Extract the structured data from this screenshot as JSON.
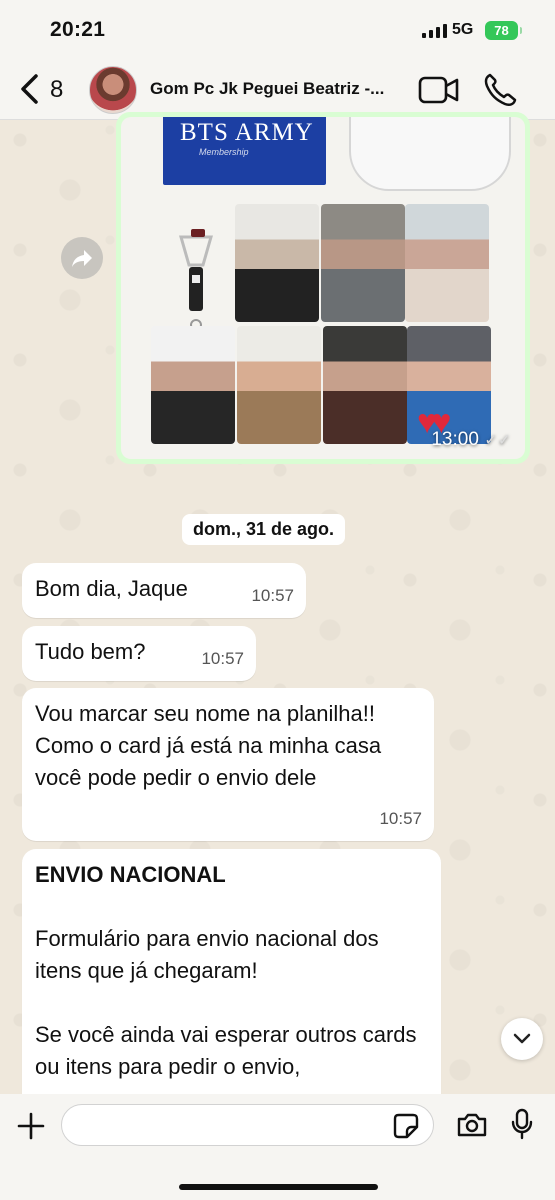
{
  "status_bar": {
    "time": "20:21",
    "network": "5G",
    "battery": "78"
  },
  "header": {
    "back_count": "8",
    "contact_name": "Gom Pc Jk Peguei Beatriz -..."
  },
  "image_message": {
    "box_title": "BTS ARMY",
    "box_subtitle": "Membership",
    "time": "13:00",
    "ticks": "✓✓"
  },
  "date_separator": "dom., 31 de ago.",
  "messages": [
    {
      "text": "Bom dia, Jaque",
      "time": "10:57"
    },
    {
      "text": "Tudo bem?",
      "time": "10:57"
    },
    {
      "text": "Vou marcar seu nome na planilha!! Como o card já está na minha casa você pode pedir o envio dele",
      "time": "10:57"
    }
  ],
  "long_message": {
    "heading": "ENVIO NACIONAL",
    "paragraph1": "Formulário para envio nacional dos itens que já chegaram!",
    "paragraph2": "Se você ainda vai esperar outros cards ou itens para pedir o envio,"
  },
  "input": {
    "placeholder": ""
  },
  "colors": {
    "outgoing_bubble": "#d9fdd3",
    "incoming_bubble": "#ffffff",
    "battery": "#34c759",
    "wallpaper": "#efe8dc"
  },
  "icons": [
    "chevron-left-icon",
    "video-call-icon",
    "phone-icon",
    "forward-icon",
    "chevron-down-icon",
    "plus-icon",
    "sticker-icon",
    "camera-icon",
    "microphone-icon"
  ]
}
